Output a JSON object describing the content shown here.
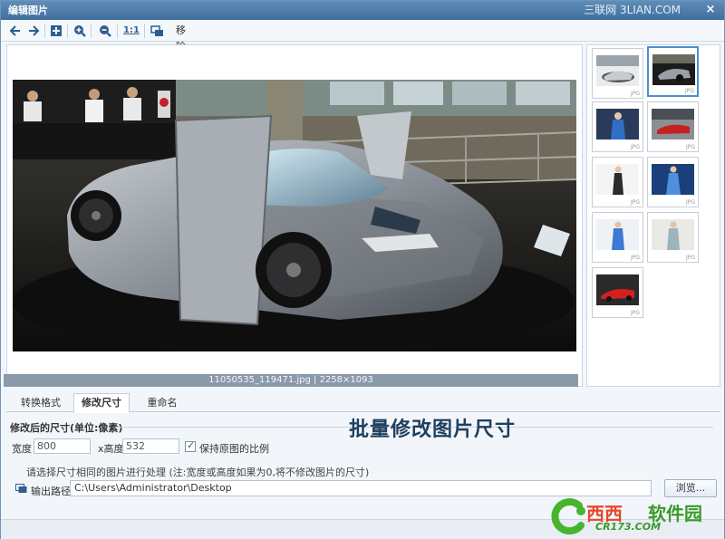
{
  "window": {
    "title": "编辑图片",
    "watermark": "三联网 3LIAN.COM",
    "close": "×"
  },
  "toolbar": {
    "move_label": "移除",
    "one_to_one": "1:1"
  },
  "preview": {
    "caption": "11050535_119471.jpg | 2258×1093"
  },
  "thumbnails": {
    "ext": "JPG",
    "items": [
      {
        "name": "car-hall",
        "selected": false
      },
      {
        "name": "car-dark",
        "selected": true
      },
      {
        "name": "model-blue",
        "selected": false
      },
      {
        "name": "red-car",
        "selected": false
      },
      {
        "name": "model-black-dress",
        "selected": false
      },
      {
        "name": "model-blue-dress",
        "selected": false
      },
      {
        "name": "model-white-blue",
        "selected": false
      },
      {
        "name": "model-standing",
        "selected": false
      },
      {
        "name": "red-car-2",
        "selected": false
      }
    ]
  },
  "tabs": [
    "转换格式",
    "修改尺寸",
    "重命名"
  ],
  "resize": {
    "section_title": "修改后的尺寸(单位:像素)",
    "banner": "批量修改图片尺寸",
    "width_label": "宽度",
    "width_value": "800",
    "height_label": "x高度",
    "height_value": "532",
    "keep_ratio_label": "保持原图的比例",
    "note": "请选择尺寸相同的图片进行处理 (注:宽度或高度如果为0,将不修改图片的尺寸)",
    "output_label": "输出路径",
    "output_value": "C:\\Users\\Administrator\\Desktop",
    "browse_label": "浏览..."
  },
  "logo": {
    "text_red": "西西",
    "text_green": "软件园",
    "sub": "CR173.COM"
  }
}
